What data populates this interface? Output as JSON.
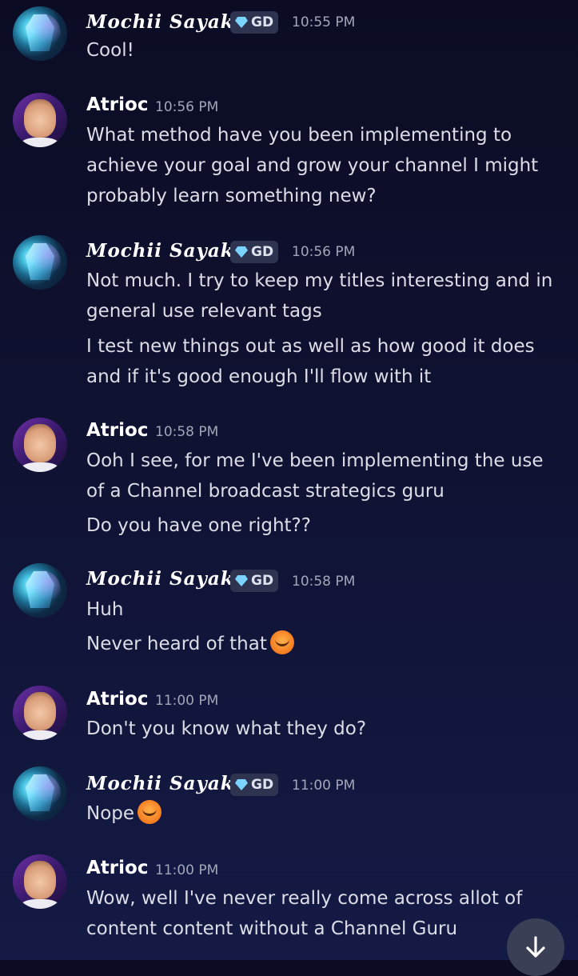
{
  "messages": [
    {
      "author": "Mochii Sayaki",
      "badge": "GD",
      "time": "10:55 PM",
      "lines": [
        "Cool!"
      ]
    },
    {
      "author": "Atrioc",
      "time": "10:56 PM",
      "lines": [
        "What method have you been implementing to achieve your goal and grow your channel I might probably learn something new?"
      ]
    },
    {
      "author": "Mochii Sayaki",
      "badge": "GD",
      "time": "10:56 PM",
      "lines": [
        "Not much. I try to keep my titles interesting and in general use relevant tags",
        "I test new things out as well as how good it does and if it's good enough I'll flow with it"
      ]
    },
    {
      "author": "Atrioc",
      "time": "10:58 PM",
      "lines": [
        "Ooh I see, for me I've been implementing the use of a Channel broadcast strategics guru",
        "Do you have one right??"
      ]
    },
    {
      "author": "Mochii Sayaki",
      "badge": "GD",
      "time": "10:58 PM",
      "lines": [
        "Huh",
        "Never heard of that"
      ]
    },
    {
      "author": "Atrioc",
      "time": "11:00 PM",
      "lines": [
        "Don't you know what they do?"
      ]
    },
    {
      "author": "Mochii Sayaki",
      "badge": "GD",
      "time": "11:00 PM",
      "lines": [
        "Nope"
      ]
    },
    {
      "author": "Atrioc",
      "time": "11:00 PM",
      "lines": [
        "Wow, well I've never really come across allot of content content without a Channel Guru"
      ]
    }
  ],
  "emojis": {
    "m4_line2": "sweat-smile-emoji",
    "m6_line1": "sweat-smile-emoji"
  },
  "scroll_button": {
    "icon": "arrow-down-icon"
  },
  "colors": {
    "background_top": "#0b0c24",
    "background_bottom": "#141a45",
    "badge_bg": "#2e3350",
    "gem": "#7ad4ff",
    "timestamp": "#a3a6b8"
  }
}
